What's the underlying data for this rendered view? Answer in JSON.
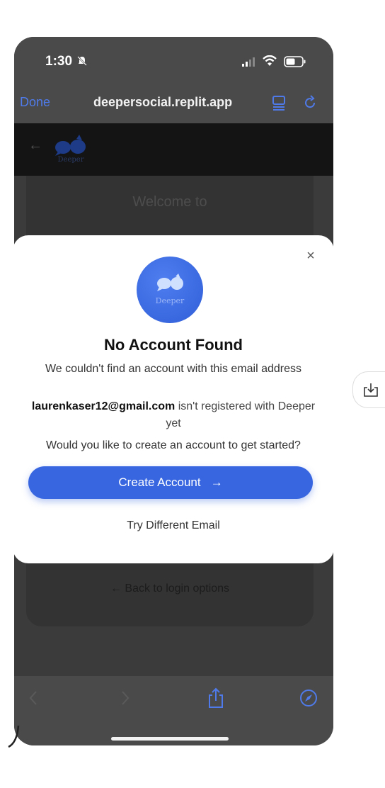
{
  "status_bar": {
    "time": "1:30"
  },
  "browser": {
    "done_label": "Done",
    "url": "deepersocial.replit.app"
  },
  "app_header": {
    "logo_text": "Deeper"
  },
  "background_card": {
    "welcome": "Welcome to",
    "back_link": "← Back to login options"
  },
  "modal": {
    "logo_text": "Deeper",
    "title": "No Account Found",
    "subtitle": "We couldn't find an account with this email address",
    "email": "laurenkaser12@gmail.com",
    "email_suffix": " isn't registered with Deeper yet",
    "question": "Would you like to create an account to get started?",
    "create_label": "Create Account",
    "create_arrow": "→",
    "try_label": "Try Different Email",
    "close_glyph": "×"
  },
  "colors": {
    "accent": "#3766e0",
    "browser_blue": "#4f7bea"
  },
  "icons": [
    "bell-slash-icon",
    "signal-icon",
    "wifi-icon",
    "battery-icon",
    "reader-icon",
    "reload-icon",
    "back-arrow-icon",
    "share-icon",
    "compass-icon",
    "download-icon"
  ]
}
